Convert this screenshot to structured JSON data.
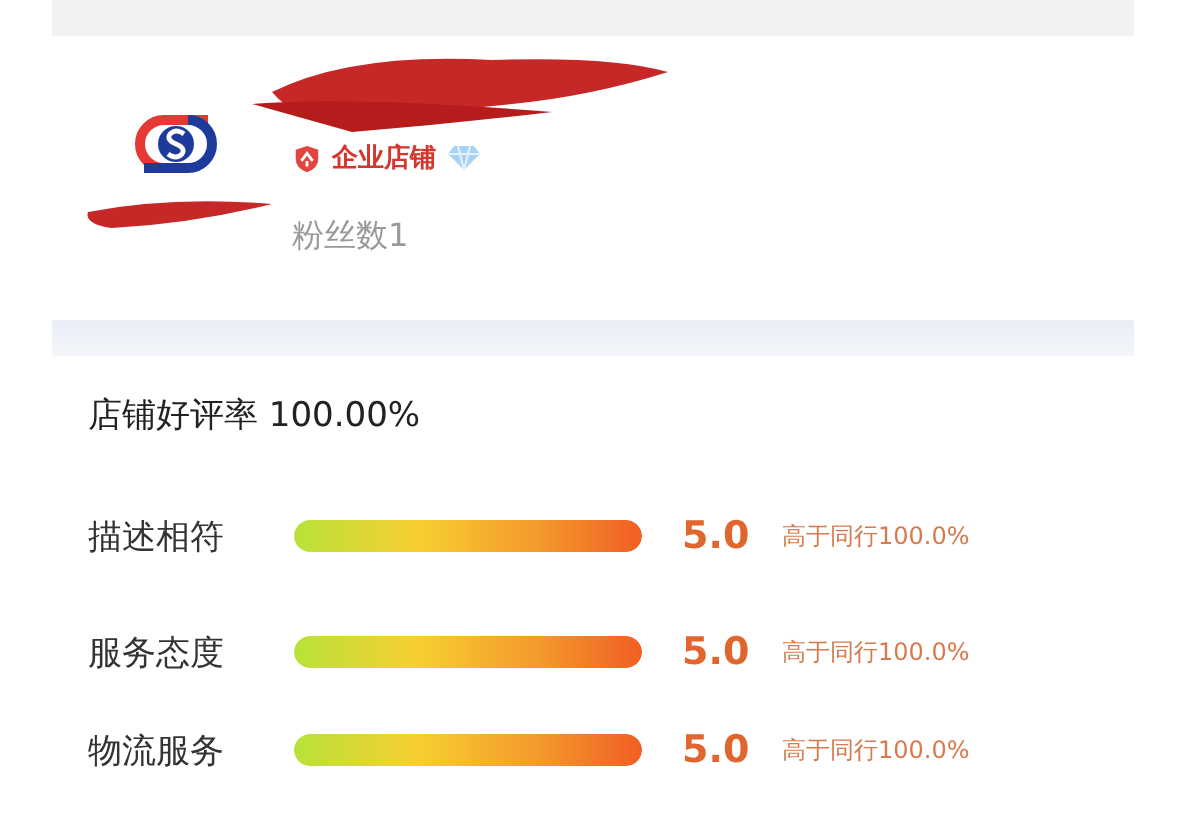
{
  "shop": {
    "badge": "企业店铺",
    "fans": "粉丝数1"
  },
  "rating": {
    "title": "店铺好评率 100.00%",
    "rows": [
      {
        "label": "描述相符",
        "level": 1,
        "score": "5.0",
        "compare": "高于同行100.0%"
      },
      {
        "label": "服务态度",
        "level": 1,
        "score": "5.0",
        "compare": "高于同行100.0%"
      },
      {
        "label": "物流服务",
        "level": 1,
        "score": "5.0",
        "compare": "高于同行100.0%"
      }
    ]
  }
}
